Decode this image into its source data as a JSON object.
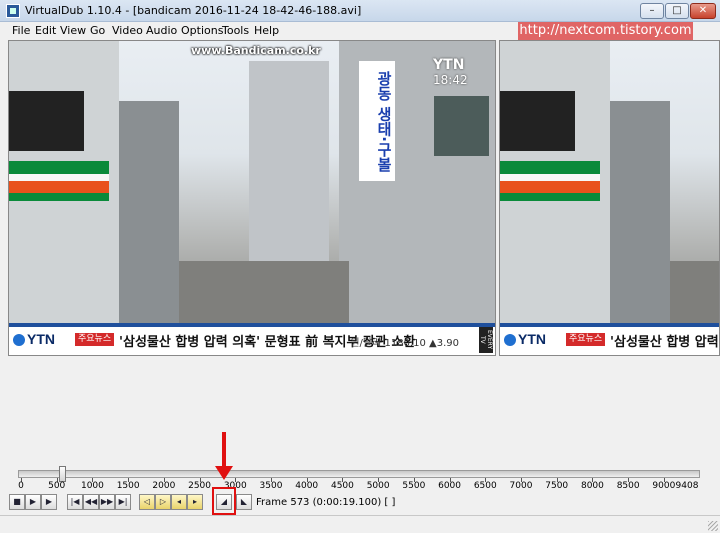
{
  "window": {
    "title": "VirtualDub 1.10.4 - [bandicam 2016-11-24 18-42-46-188.avi]",
    "minimize": "–",
    "maximize": "□",
    "close": "✕"
  },
  "menu": [
    "File",
    "Edit",
    "View",
    "Go",
    "Video",
    "Audio",
    "Options",
    "Tools",
    "Help"
  ],
  "watermark": "http://nextcom.tistory.com",
  "video": {
    "osd_site": "www.Bandicam.co.kr",
    "osd_channel": "YTN",
    "osd_time": "18:42",
    "sign_text": "광동 생태·구볼",
    "ticker_brand": "YTN",
    "ticker_tag": "주요뉴스",
    "ticker_headline": "'삼성물산 합병 압력 의혹' 문형표 前 복지부 장관 소환",
    "ticker_rate": "원/달러 1180.10 ▲3.90",
    "ticker_side": "EVERY TV",
    "out_ticker_headline": "'삼성물산 합병 압력 의혹'"
  },
  "timeline": {
    "max": 9408,
    "current_frame": 573,
    "ticks": [
      0,
      500,
      1000,
      1500,
      2000,
      2500,
      3000,
      3500,
      4000,
      4500,
      5000,
      5500,
      6000,
      6500,
      7000,
      7500,
      8000,
      8500,
      9000
    ]
  },
  "toolbar": {
    "buttons": [
      {
        "name": "stop-button",
        "glyph": "■"
      },
      {
        "name": "play-input-button",
        "glyph": "▶"
      },
      {
        "name": "play-output-button",
        "glyph": "▶"
      },
      {
        "name": "go-start-button",
        "glyph": "|◀"
      },
      {
        "name": "go-back-button",
        "glyph": "◀◀"
      },
      {
        "name": "go-forward-button",
        "glyph": "▶▶"
      },
      {
        "name": "go-end-button",
        "glyph": "▶|"
      },
      {
        "name": "prev-keyframe-button",
        "glyph": "◁"
      },
      {
        "name": "next-keyframe-button",
        "glyph": "▷"
      },
      {
        "name": "scene-back-button",
        "glyph": "◂"
      },
      {
        "name": "scene-forward-button",
        "glyph": "▸"
      },
      {
        "name": "mark-in-button",
        "glyph": "◢"
      },
      {
        "name": "mark-out-button",
        "glyph": "◣"
      }
    ],
    "frame_readout": "Frame 573 (0:00:19.100) [ ]"
  },
  "colors": {
    "highlight": "#e01010",
    "watermark_bg": "#e06565"
  }
}
